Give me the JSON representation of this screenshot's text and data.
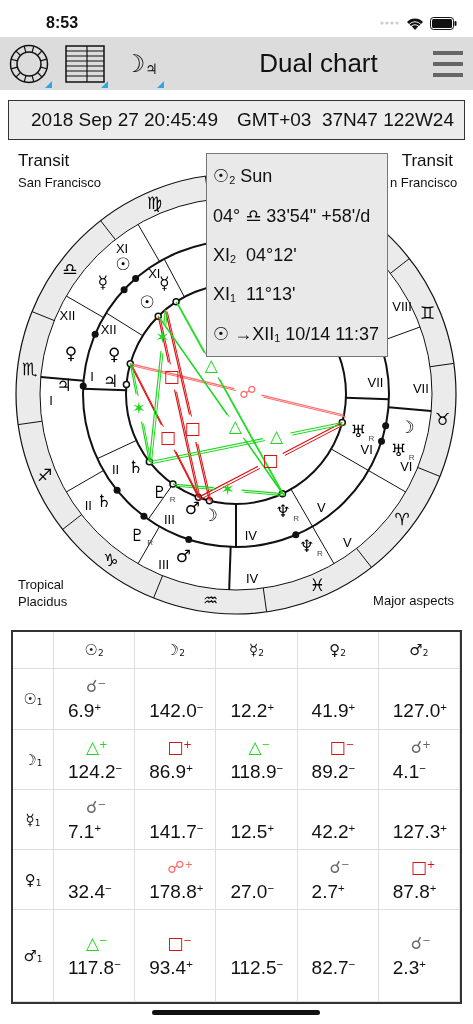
{
  "status_bar": {
    "time": "8:53"
  },
  "toolbar": {
    "buttons": [
      {
        "kind": "wheel"
      },
      {
        "kind": "grid"
      },
      {
        "kind": "glyph",
        "text": "☽$_{♃}$"
      }
    ],
    "title": "Dual chart"
  },
  "info_bar": {
    "datetime": "2018 Sep 27 20:45:49",
    "location": "GMT+03  37N47 122W24"
  },
  "chart": {
    "top_left": {
      "title": "Transit",
      "subtitle": "San Francisco"
    },
    "top_right": {
      "title": "Transit",
      "subtitle": "n Francisco"
    },
    "bottom_left": [
      "Tropical",
      "Placidus"
    ],
    "bottom_right": "Major aspects",
    "signs": [
      "♈",
      "♉",
      "♊",
      "♍",
      "♎",
      "♏",
      "♐",
      "♑",
      "♒",
      "♓"
    ],
    "outer_houses": [
      "I",
      "II",
      "III",
      "IV",
      "V",
      "VI",
      "VII",
      "VIII",
      "XI",
      "XII"
    ],
    "inner_houses": [
      "I",
      "II",
      "III",
      "IV",
      "V",
      "VI",
      "VII",
      "XI",
      "XII"
    ],
    "transit_planets": [
      {
        "glyph": "☉"
      },
      {
        "glyph": "☿"
      },
      {
        "glyph": "♀"
      },
      {
        "glyph": "♃"
      },
      {
        "glyph": "♄"
      },
      {
        "glyph": "♇",
        "mark": "R"
      },
      {
        "glyph": "♂"
      },
      {
        "glyph": "♆",
        "mark": "R"
      },
      {
        "glyph": "☽"
      },
      {
        "glyph": "♅",
        "mark": "R"
      }
    ],
    "natal_planets": [
      {
        "glyph": "☉"
      },
      {
        "glyph": "☿"
      },
      {
        "glyph": "♀"
      },
      {
        "glyph": "♃"
      },
      {
        "glyph": "♄"
      },
      {
        "glyph": "♇",
        "mark": "R"
      },
      {
        "glyph": "♂"
      },
      {
        "glyph": "☽"
      },
      {
        "glyph": "♆",
        "mark": "R"
      },
      {
        "glyph": "♅",
        "mark": "R"
      }
    ],
    "aspects": [
      {
        "kind": "opposition",
        "symbol": "☍"
      },
      {
        "kind": "square",
        "symbol": "□"
      },
      {
        "kind": "square",
        "symbol": "□"
      },
      {
        "kind": "square",
        "symbol": "□"
      },
      {
        "kind": "trine",
        "symbol": "△"
      },
      {
        "kind": "trine",
        "symbol": "△"
      },
      {
        "kind": "sextile",
        "symbol": "✶"
      },
      {
        "kind": "square",
        "symbol": "□"
      },
      {
        "kind": "trine",
        "symbol": "△"
      },
      {
        "kind": "sextile",
        "symbol": "✶"
      },
      {
        "kind": "sextile",
        "symbol": "✶"
      }
    ],
    "popup": [
      "☉$_{2}$ Sun",
      "04° ♎ 33'54\" +58'/d",
      "XI$_{2}$  04°12'",
      "XI$_{1}$  11°13'",
      "☉ →XII$_{1}$ 10/14 11:37"
    ]
  },
  "aspect_table": {
    "columns": [
      "☉$_{2}$",
      "☽$_{2}$",
      "☿$_{2}$",
      "♀$_{2}$",
      "♂$_{2}$"
    ],
    "rows": [
      {
        "label": "☉$_{1}$",
        "cells": [
          {
            "aspect": {
              "kind": "conjunction",
              "symbol": "☌$^{−}$"
            },
            "value": "6.9$^{+}$"
          },
          {
            "value": "142.0$^{−}$"
          },
          {
            "value": "12.2$^{+}$"
          },
          {
            "value": "41.9$^{+}$"
          },
          {
            "value": "127.0$^{+}$"
          }
        ]
      },
      {
        "label": "☽$_{1}$",
        "cells": [
          {
            "aspect": {
              "kind": "trine",
              "symbol": "△$^{+}$"
            },
            "value": "124.2$^{−}$"
          },
          {
            "aspect": {
              "kind": "square",
              "symbol": "□$^{+}$"
            },
            "value": "86.9$^{+}$"
          },
          {
            "aspect": {
              "kind": "trine",
              "symbol": "△$^{−}$"
            },
            "value": "118.9$^{−}$"
          },
          {
            "aspect": {
              "kind": "square",
              "symbol": "□$^{−}$"
            },
            "value": "89.2$^{−}$"
          },
          {
            "aspect": {
              "kind": "conjunction",
              "symbol": "☌$^{+}$"
            },
            "value": "4.1$^{−}$"
          }
        ]
      },
      {
        "label": "☿$_{1}$",
        "cells": [
          {
            "aspect": {
              "kind": "conjunction",
              "symbol": "☌$^{−}$"
            },
            "value": "7.1$^{+}$"
          },
          {
            "value": "141.7$^{−}$"
          },
          {
            "value": "12.5$^{+}$"
          },
          {
            "value": "42.2$^{+}$"
          },
          {
            "value": "127.3$^{+}$"
          }
        ]
      },
      {
        "label": "♀$_{1}$",
        "cells": [
          {
            "value": "32.4$^{−}$"
          },
          {
            "aspect": {
              "kind": "opposition",
              "symbol": "☍$^{+}$"
            },
            "value": "178.8$^{+}$"
          },
          {
            "value": "27.0$^{−}$"
          },
          {
            "aspect": {
              "kind": "conjunction",
              "symbol": "☌$^{−}$"
            },
            "value": "2.7$^{+}$"
          },
          {
            "aspect": {
              "kind": "square",
              "symbol": "□$^{+}$"
            },
            "value": "87.8$^{+}$"
          }
        ]
      },
      {
        "label": "♂$_{1}$",
        "cells": [
          {
            "aspect": {
              "kind": "trine",
              "symbol": "△$^{−}$"
            },
            "value": "117.8$^{−}$"
          },
          {
            "aspect": {
              "kind": "square",
              "symbol": "□$^{−}$"
            },
            "value": "93.4$^{+}$"
          },
          {
            "value": "112.5$^{−}$"
          },
          {
            "value": "82.7$^{−}$"
          },
          {
            "aspect": {
              "kind": "conjunction",
              "symbol": "☌$^{−}$"
            },
            "value": "2.3$^{+}$"
          }
        ]
      }
    ]
  }
}
